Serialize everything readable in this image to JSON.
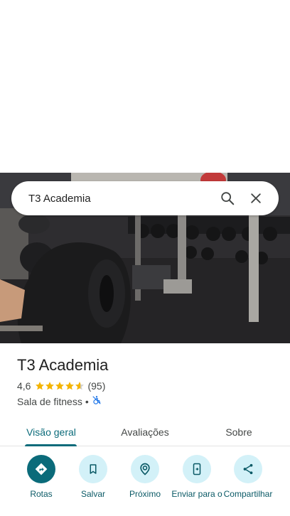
{
  "search": {
    "query": "T3 Academia"
  },
  "place": {
    "name": "T3 Academia",
    "rating": "4,6",
    "stars": 4.6,
    "review_count": "(95)",
    "category": "Sala de fitness",
    "separator": "•"
  },
  "tabs": [
    {
      "label": "Visão geral",
      "active": true
    },
    {
      "label": "Avaliações",
      "active": false
    },
    {
      "label": "Sobre",
      "active": false
    }
  ],
  "actions": [
    {
      "label": "Rotas",
      "icon": "directions-icon"
    },
    {
      "label": "Salvar",
      "icon": "bookmark-icon"
    },
    {
      "label": "Próximo",
      "icon": "nearby-icon"
    },
    {
      "label": "Enviar para o",
      "icon": "send-to-phone-icon"
    },
    {
      "label": "Compartilhar",
      "icon": "share-icon"
    }
  ],
  "colors": {
    "accent": "#0b6b7a",
    "chip": "#d3f1f8",
    "star": "#f4b400"
  }
}
